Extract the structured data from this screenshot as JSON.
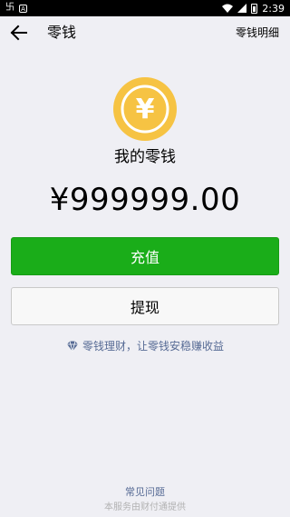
{
  "status_bar": {
    "left_icons": [
      "app-notification-icon",
      "text-icon"
    ],
    "time": "2:39",
    "right_icons": [
      "wifi-icon",
      "signal-icon",
      "battery-icon"
    ]
  },
  "header": {
    "title": "零钱",
    "details_link": "零钱明细"
  },
  "wallet": {
    "coin_symbol": "¥",
    "label": "我的零钱",
    "amount": "¥999999.00"
  },
  "actions": {
    "topup_label": "充值",
    "withdraw_label": "提现"
  },
  "promo": {
    "text": "零钱理财，让零钱安稳赚收益",
    "icon": "diamond-icon"
  },
  "footer": {
    "faq": "常见问题",
    "provider": "本服务由财付通提供"
  },
  "colors": {
    "background": "#efeff4",
    "primary_green": "#1aad19",
    "link_blue": "#576b95",
    "coin_yellow": "#f6c343"
  }
}
